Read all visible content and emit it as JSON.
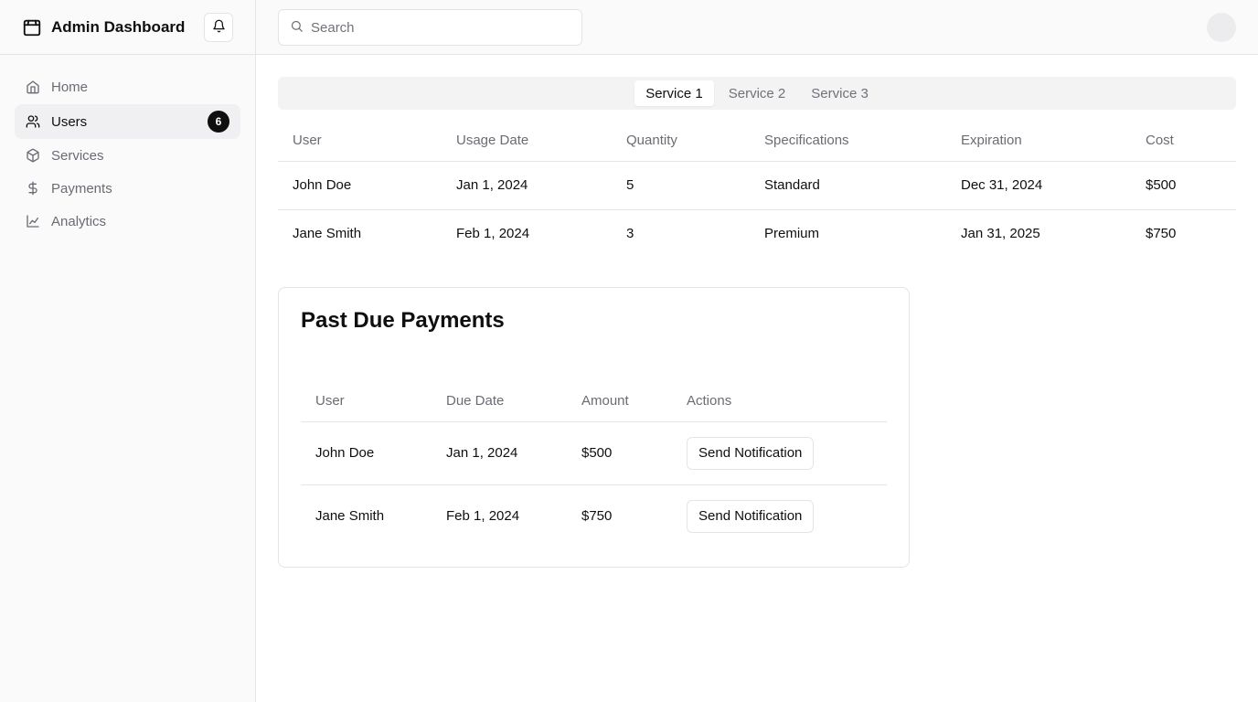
{
  "app": {
    "title": "Admin Dashboard"
  },
  "sidebar": {
    "items": [
      {
        "label": "Home",
        "icon": "home-icon"
      },
      {
        "label": "Users",
        "icon": "users-icon",
        "badge": "6"
      },
      {
        "label": "Services",
        "icon": "package-icon"
      },
      {
        "label": "Payments",
        "icon": "dollar-icon"
      },
      {
        "label": "Analytics",
        "icon": "line-chart-icon"
      }
    ]
  },
  "header": {
    "search_placeholder": "Search"
  },
  "tabs": [
    "Service 1",
    "Service 2",
    "Service 3"
  ],
  "service_table": {
    "headers": [
      "User",
      "Usage Date",
      "Quantity",
      "Specifications",
      "Expiration",
      "Cost"
    ],
    "rows": [
      [
        "John Doe",
        "Jan 1, 2024",
        "5",
        "Standard",
        "Dec 31, 2024",
        "$500"
      ],
      [
        "Jane Smith",
        "Feb 1, 2024",
        "3",
        "Premium",
        "Jan 31, 2025",
        "$750"
      ]
    ]
  },
  "past_due": {
    "title": "Past Due Payments",
    "headers": [
      "User",
      "Due Date",
      "Amount",
      "Actions"
    ],
    "rows": [
      {
        "user": "John Doe",
        "due": "Jan 1, 2024",
        "amount": "$500",
        "action": "Send Notification"
      },
      {
        "user": "Jane Smith",
        "due": "Feb 1, 2024",
        "amount": "$750",
        "action": "Send Notification"
      }
    ]
  },
  "colors": {
    "active_bg": "#f0f0f2",
    "badge_bg": "#0f0f10",
    "muted_text": "#6b6b74"
  }
}
